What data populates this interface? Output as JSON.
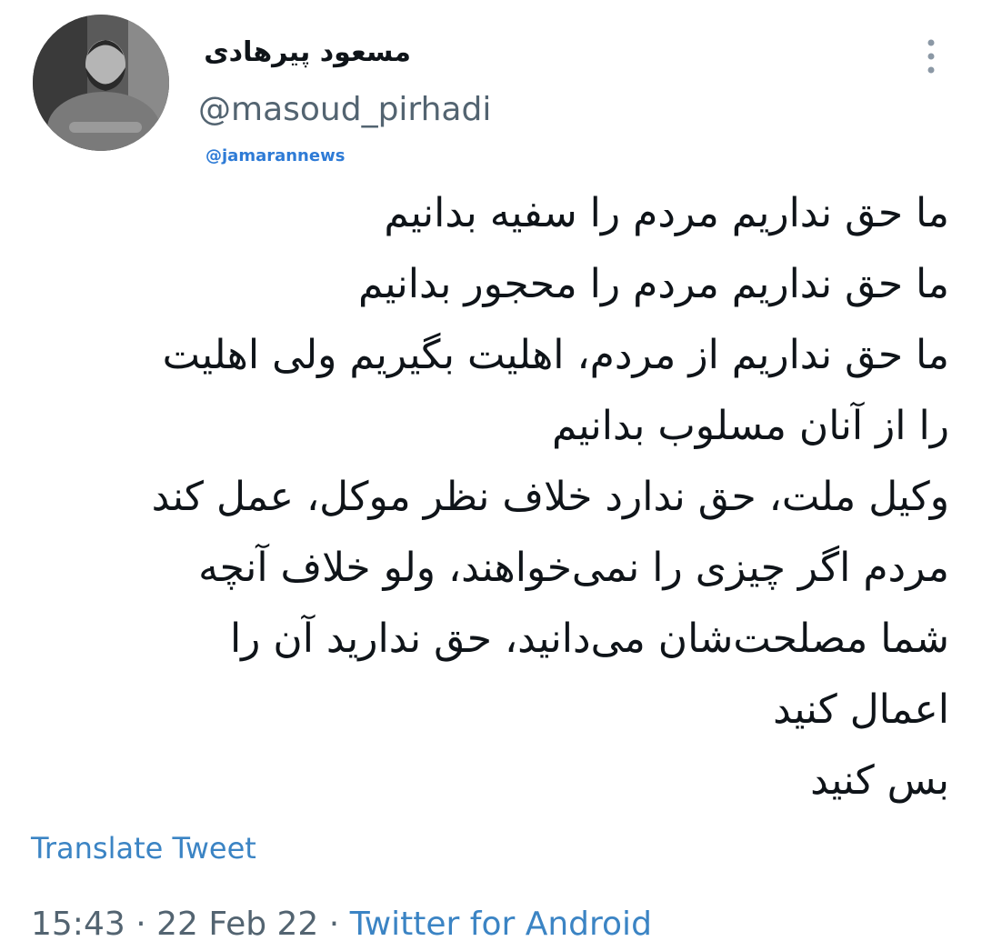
{
  "author": {
    "display_name": "مسعود پیرهادی",
    "handle": "@masoud_pirhadi"
  },
  "watermark": "@jamarannews",
  "tweet": {
    "lines": [
      "ما حق نداریم مردم را سفیه بدانیم",
      "ما حق نداریم مردم را محجور بدانیم",
      "ما حق نداریم از مردم، اهلیت بگیریم ولی اهلیت",
      "را از آنان مسلوب بدانیم",
      "وکیل ملت، حق ندارد خلاف نظر موکل، عمل کند",
      "مردم اگر چیزی را نمی‌خواهند، ولو خلاف آنچه",
      "شما مصلحت‌شان می‌دانید، حق ندارید آن را",
      "اعمال کنید",
      "بس کنید"
    ]
  },
  "translate_label": "Translate Tweet",
  "meta": {
    "time": "15:43",
    "separator1": " · ",
    "date": "22 Feb 22",
    "separator2": " · ",
    "source": "Twitter for Android"
  },
  "icons": {
    "more": "more-vertical-icon"
  },
  "colors": {
    "link": "#3b84c4",
    "secondary_text": "#536471",
    "watermark": "#2e7bd6"
  }
}
